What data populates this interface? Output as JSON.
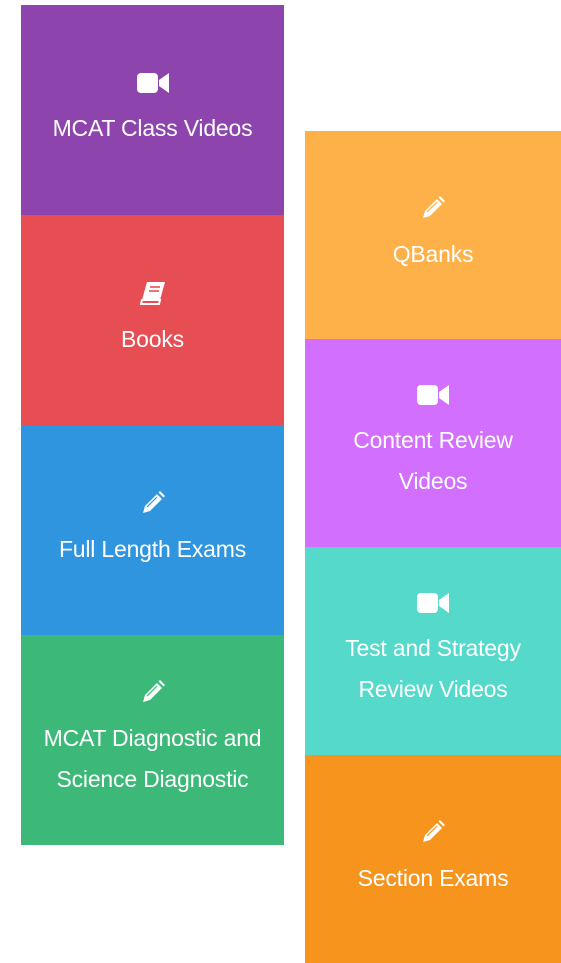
{
  "tiles": {
    "class_videos": {
      "label": "MCAT Class Videos",
      "icon": "video-camera-icon",
      "color": "#8e44ad"
    },
    "books": {
      "label": "Books",
      "icon": "book-icon",
      "color": "#e74e54"
    },
    "full_length": {
      "label": "Full Length Exams",
      "icon": "pencil-icon",
      "color": "#2e95de"
    },
    "diagnostic": {
      "label": "MCAT Diagnostic and Science Diagnostic",
      "icon": "pencil-icon",
      "color": "#3cb878"
    },
    "qbanks": {
      "label": "QBanks",
      "icon": "pencil-icon",
      "color": "#fdb148"
    },
    "content_review": {
      "label": "Content Review Videos",
      "icon": "video-camera-icon",
      "color": "#d26ffe"
    },
    "test_strategy": {
      "label": "Test and Strategy Review Videos",
      "icon": "video-camera-icon",
      "color": "#55d9cb"
    },
    "section_exams": {
      "label": "Section Exams",
      "icon": "pencil-icon",
      "color": "#f7941d"
    }
  }
}
